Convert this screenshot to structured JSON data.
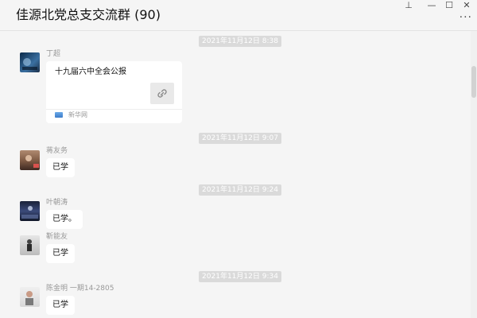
{
  "window": {
    "title": "佳源北党总支交流群 (90)",
    "controls": {
      "pin": "⊥",
      "minimize": "—",
      "maximize": "☐",
      "close": "✕",
      "more": "···"
    }
  },
  "messages": [
    {
      "timestamp": "2021年11月12日 8:38"
    },
    {
      "sender": "丁超",
      "link_card": {
        "title": "十九届六中全会公报",
        "source": "新华网",
        "icon": "link-icon"
      }
    },
    {
      "timestamp": "2021年11月12日 9:07"
    },
    {
      "sender": "蒋友务",
      "text": "已学"
    },
    {
      "timestamp": "2021年11月12日 9:24"
    },
    {
      "sender": "叶朝涛",
      "text": "已学。"
    },
    {
      "sender": "靳能友",
      "text": "已学"
    },
    {
      "timestamp": "2021年11月12日 9:34"
    },
    {
      "sender": "陈金明 一期14-2805",
      "text": "已学"
    }
  ],
  "colors": {
    "background": "#f5f5f5",
    "bubble": "#ffffff",
    "timestamp_bg": "#dadada",
    "sender_text": "#999999"
  }
}
